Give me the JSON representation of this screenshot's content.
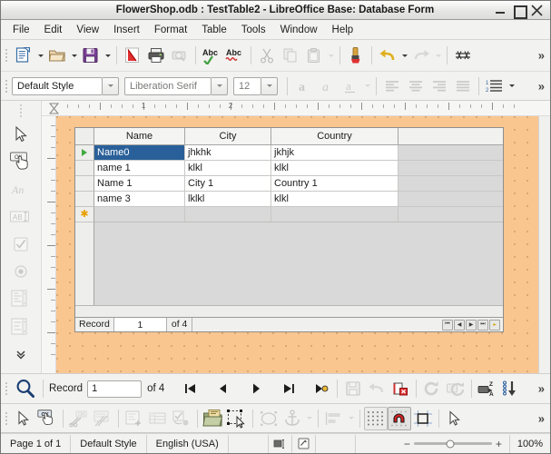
{
  "window": {
    "title": "FlowerShop.odb : TestTable2 - LibreOffice Base: Database Form",
    "minimize_label": "Minimize",
    "maximize_label": "Maximize",
    "close_label": "Close"
  },
  "menubar": {
    "items": [
      {
        "label": "File"
      },
      {
        "label": "Edit"
      },
      {
        "label": "View"
      },
      {
        "label": "Insert"
      },
      {
        "label": "Format"
      },
      {
        "label": "Table"
      },
      {
        "label": "Tools"
      },
      {
        "label": "Window"
      },
      {
        "label": "Help"
      }
    ]
  },
  "main_toolbar": {
    "overflow_label": "»",
    "items": [
      {
        "name": "new-document",
        "title": "New"
      },
      {
        "name": "open-document",
        "title": "Open"
      },
      {
        "name": "save-document",
        "title": "Save"
      },
      {
        "name": "export-pdf",
        "title": "Export as PDF"
      },
      {
        "name": "print",
        "title": "Print"
      },
      {
        "name": "print-preview",
        "title": "Print Preview"
      },
      {
        "name": "spelling",
        "title": "Spelling"
      },
      {
        "name": "autospellcheck",
        "title": "Auto Spellcheck"
      },
      {
        "name": "cut",
        "title": "Cut"
      },
      {
        "name": "copy",
        "title": "Copy"
      },
      {
        "name": "paste",
        "title": "Paste"
      },
      {
        "name": "clone-formatting",
        "title": "Clone Formatting"
      },
      {
        "name": "undo",
        "title": "Undo"
      },
      {
        "name": "redo",
        "title": "Redo"
      },
      {
        "name": "formatting-marks",
        "title": "Formatting Marks"
      }
    ]
  },
  "format_toolbar": {
    "paragraph_style": "Default Style",
    "font_name": "Liberation Serif",
    "font_size": "12",
    "overflow_label": "»",
    "items": [
      {
        "name": "bold",
        "title": "Bold"
      },
      {
        "name": "italic",
        "title": "Italic"
      },
      {
        "name": "underline",
        "title": "Underline"
      },
      {
        "name": "align-left",
        "title": "Align Left"
      },
      {
        "name": "align-center",
        "title": "Align Center"
      },
      {
        "name": "align-right",
        "title": "Align Right"
      },
      {
        "name": "align-justified",
        "title": "Justified"
      },
      {
        "name": "ordered-list",
        "title": "Ordered List"
      }
    ]
  },
  "form_controls_sidebar": {
    "items": [
      {
        "name": "select-tool",
        "title": "Select"
      },
      {
        "name": "push-button-tool",
        "title": "Push Button"
      },
      {
        "name": "label-field-tool",
        "title": "Label Field",
        "glyph": "An"
      },
      {
        "name": "text-box-tool",
        "title": "Text Box",
        "glyph": "ABI"
      },
      {
        "name": "check-box-tool",
        "title": "Check Box"
      },
      {
        "name": "option-button-tool",
        "title": "Option Button"
      },
      {
        "name": "list-box-tool",
        "title": "List Box"
      },
      {
        "name": "combo-box-tool",
        "title": "Combo Box"
      },
      {
        "name": "more-controls",
        "title": "More Controls",
        "glyph": "ˇ"
      }
    ]
  },
  "ruler": {
    "horizontal_numbers": [
      "1",
      "2"
    ],
    "unit": "inch"
  },
  "table_grid": {
    "columns": [
      "Name",
      "City",
      "Country"
    ],
    "rows": [
      {
        "selected": true,
        "current": true,
        "cells": [
          "Name0",
          "jhkhk",
          "jkhjk"
        ]
      },
      {
        "selected": false,
        "current": false,
        "cells": [
          "name 1",
          "klkl",
          "klkl"
        ]
      },
      {
        "selected": false,
        "current": false,
        "cells": [
          "Name 1",
          "City 1",
          "Country 1"
        ]
      },
      {
        "selected": false,
        "current": false,
        "cells": [
          "name 3",
          "lklkl",
          "klkl"
        ]
      }
    ],
    "new_row_marker": "✱",
    "navigation": {
      "record_label": "Record",
      "record_value": "1",
      "of_label": "of 4",
      "buttons": [
        {
          "name": "grid-first-record",
          "glyph": "⏮"
        },
        {
          "name": "grid-prev-record",
          "glyph": "◀"
        },
        {
          "name": "grid-next-record",
          "glyph": "▶"
        },
        {
          "name": "grid-last-record",
          "glyph": "⏭"
        },
        {
          "name": "grid-new-record",
          "glyph": "▸"
        }
      ]
    }
  },
  "nav_toolbar": {
    "search_title": "Find Record",
    "record_label": "Record",
    "record_value": "1",
    "record_placeholder": "1",
    "of_label": "of  4",
    "overflow_label": "»",
    "items": [
      {
        "name": "first-record",
        "title": "First Record"
      },
      {
        "name": "previous-record",
        "title": "Previous Record"
      },
      {
        "name": "next-record",
        "title": "Next Record"
      },
      {
        "name": "last-record",
        "title": "Last Record"
      },
      {
        "name": "new-record",
        "title": "New Record"
      },
      {
        "name": "save-record",
        "title": "Save Record"
      },
      {
        "name": "undo-entry",
        "title": "Undo: Data entry"
      },
      {
        "name": "delete-record",
        "title": "Delete Record"
      },
      {
        "name": "refresh",
        "title": "Refresh"
      },
      {
        "name": "refresh-control",
        "title": "Refresh Control"
      },
      {
        "name": "sort-ascending",
        "title": "Sort Ascending"
      },
      {
        "name": "sort-order",
        "title": "Sort Order"
      }
    ]
  },
  "design_toolbar": {
    "overflow_label": "»",
    "items": [
      {
        "name": "design-select-tool",
        "title": "Select"
      },
      {
        "name": "design-mode-toggle",
        "title": "Design Mode On/Off"
      },
      {
        "name": "control-wizards",
        "title": "Form Control Wizards"
      },
      {
        "name": "open-in-design-mode",
        "title": "Open in Design Mode"
      },
      {
        "name": "form-properties",
        "title": "Form Properties"
      },
      {
        "name": "form-navigator",
        "title": "Form Navigator"
      },
      {
        "name": "activation-order",
        "title": "Activation Order"
      },
      {
        "name": "add-field",
        "title": "Add Field"
      },
      {
        "name": "select-controls",
        "title": "Select Controls"
      },
      {
        "name": "display-grid",
        "title": "Display Grid"
      },
      {
        "name": "anchor",
        "title": "Anchor"
      },
      {
        "name": "align-objects",
        "title": "Align Objects"
      },
      {
        "name": "grid-visible",
        "title": "Grid Visible"
      },
      {
        "name": "snap-to-grid",
        "title": "Snap to Grid",
        "active": true
      },
      {
        "name": "helplines-while-moving",
        "title": "Helplines While Moving"
      },
      {
        "name": "design-arrow",
        "title": "Pointer"
      }
    ]
  },
  "statusbar": {
    "page": "Page 1 of 1",
    "style": "Default Style",
    "language": "English (USA)",
    "selection_mode": "",
    "zoom_minus": "−",
    "zoom_plus": "+",
    "zoom_level": "100%"
  },
  "colors": {
    "form_background": "#f9c690",
    "selection_blue": "#2a6099",
    "current_row_green": "#3faa3f",
    "new_row_orange": "#e8a000",
    "toolbar_bg": "#f2f2f0"
  }
}
